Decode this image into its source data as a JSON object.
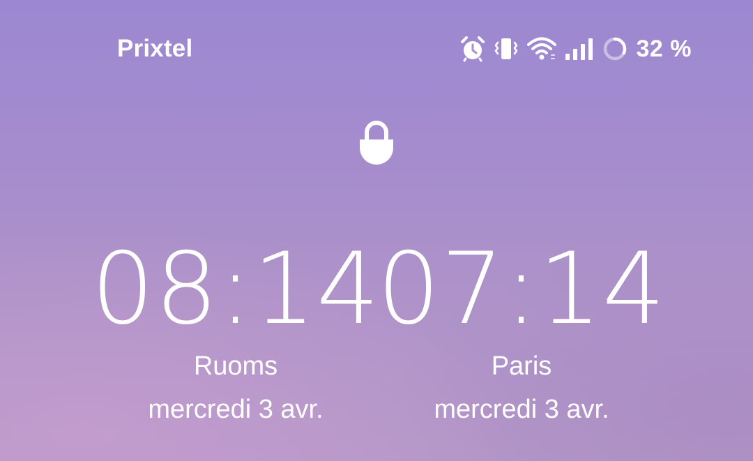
{
  "status_bar": {
    "carrier": "Prixtel",
    "icons": [
      "alarm-icon",
      "vibrate-icon",
      "wifi-icon",
      "signal-icon",
      "battery-ring-icon"
    ],
    "battery_level": 0.32,
    "battery_text": "32 %"
  },
  "lock_icon": "lock-icon",
  "clocks": [
    {
      "time": "08:14",
      "city": "Ruoms",
      "date": "mercredi 3 avr."
    },
    {
      "time": "07:14",
      "city": "Paris",
      "date": "mercredi 3 avr."
    }
  ],
  "colors": {
    "text": "#ffffff",
    "background_top": "#9c88d2",
    "background_bottom": "#b598c8"
  }
}
